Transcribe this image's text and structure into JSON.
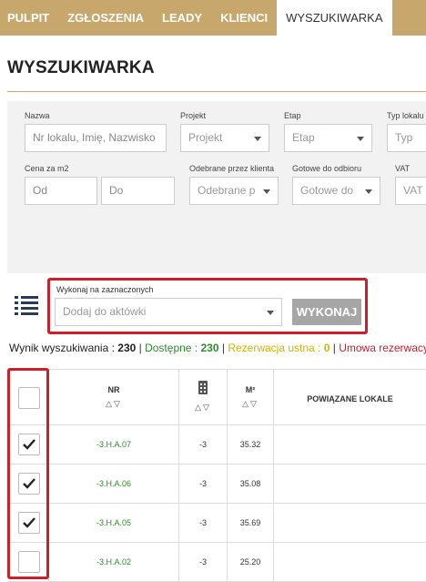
{
  "nav": {
    "tabs": [
      {
        "label": "PULPIT"
      },
      {
        "label": "ZGŁOSZENIA"
      },
      {
        "label": "LEADY"
      },
      {
        "label": "KLIENCI"
      },
      {
        "label": "WYSZUKIWARKA",
        "active": true
      }
    ],
    "accent_color": "#c7a76c"
  },
  "page": {
    "title": "WYSZUKIWARKA"
  },
  "filters": {
    "nazwa": {
      "label": "Nazwa",
      "placeholder": "Nr lokalu, Imię, Nazwisko"
    },
    "projekt": {
      "label": "Projekt",
      "value": "Projekt"
    },
    "etap": {
      "label": "Etap",
      "value": "Etap"
    },
    "typ_lokalu": {
      "label": "Typ lokalu",
      "value": "Typ"
    },
    "cena_m2": {
      "label": "Cena za m2",
      "from_placeholder": "Od",
      "to_placeholder": "Do"
    },
    "odebrane": {
      "label": "Odebrane przez klienta",
      "value": "Odebrane p"
    },
    "gotowe": {
      "label": "Gotowe do odbioru",
      "value": "Gotowe do"
    },
    "vat": {
      "label": "VAT",
      "value": "VAT"
    }
  },
  "bulk_actions": {
    "label": "Wykonaj na zaznaczonych",
    "select_value": "Dodaj do aktówki",
    "button_label": "WYKONAJ",
    "highlight_color": "#cc1f2a"
  },
  "summary": {
    "results_label": "Wynik wyszukiwania :",
    "results_count": "230",
    "available_label": "Dostępne :",
    "available_count": "230",
    "oral_label": "Rezerwacja ustna :",
    "oral_count": "0",
    "contract_label": "Umowa rezerwacyjna"
  },
  "table": {
    "columns": [
      {
        "key": "select",
        "label": ""
      },
      {
        "key": "nr",
        "label": "NR",
        "sortable": true
      },
      {
        "key": "building",
        "label": "",
        "icon": "building-icon",
        "sortable": true
      },
      {
        "key": "floor_area",
        "label": "M²",
        "sortable": true
      },
      {
        "key": "related",
        "label": "POWIĄZANE LOKALE"
      }
    ],
    "sort_arrows": "△▽",
    "rows": [
      {
        "checked": true,
        "nr": "-3.H.A.07",
        "floor": "-3",
        "area": "35.32",
        "related": ""
      },
      {
        "checked": true,
        "nr": "-3.H.A.06",
        "floor": "-3",
        "area": "35.08",
        "related": ""
      },
      {
        "checked": true,
        "nr": "-3.H.A.05",
        "floor": "-3",
        "area": "35.69",
        "related": ""
      },
      {
        "checked": false,
        "nr": "-3.H.A.02",
        "floor": "-3",
        "area": "25.20",
        "related": ""
      }
    ]
  }
}
